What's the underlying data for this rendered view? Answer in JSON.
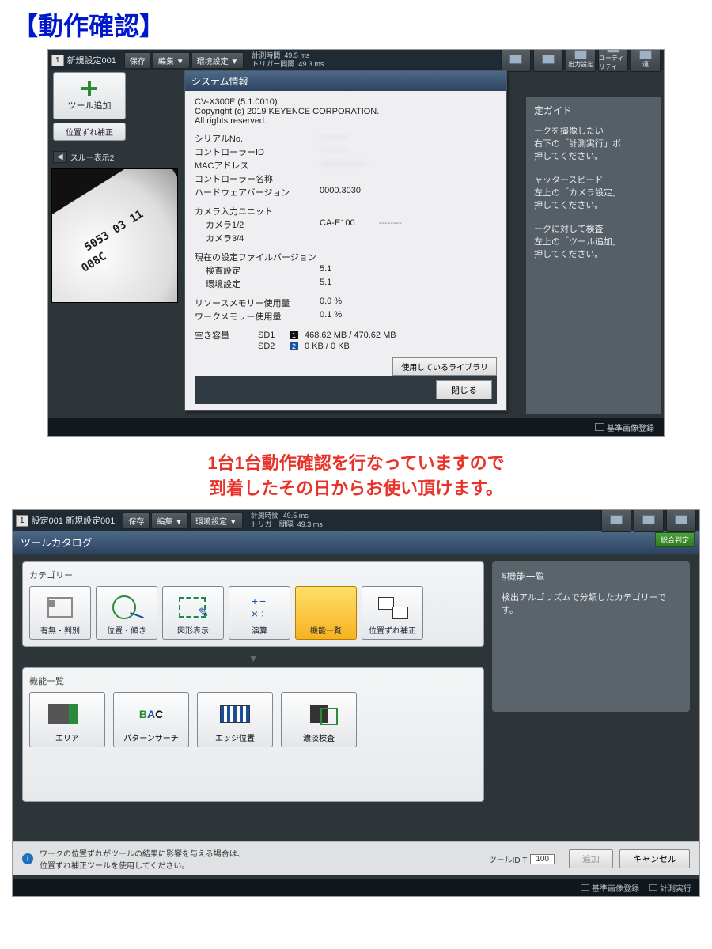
{
  "heading": "【動作確認】",
  "caption_line1": "1台1台動作確認を行なっていますので",
  "caption_line2": "到着したその日からお使い頂けます。",
  "shot1": {
    "appbar": {
      "index": "1",
      "title": "新規設定001",
      "menus": {
        "save": "保存",
        "edit": "編集 ▼",
        "env": "環境設定 ▼"
      },
      "stats": {
        "measure_time_label": "計測時間",
        "measure_time_val": "49.5 ms",
        "trigger_label": "トリガー間隔",
        "trigger_val": "49.3 ms"
      },
      "topicons": {
        "output": "出力設定",
        "utility": "ユーティリティ",
        "run": "運"
      }
    },
    "left_tools": {
      "add_tool": "ツール追加",
      "align_correct": "位置ずれ補正",
      "through": "スルー表示2"
    },
    "preview": {
      "line1": "5053 03 11",
      "line2": "008C"
    },
    "sysinfo": {
      "title": "システム情報",
      "model": "CV-X300E (5.1.0010)",
      "copyright": "Copyright (c) 2019 KEYENCE CORPORATION.",
      "rights": "All rights reserved.",
      "rows": {
        "serial_k": "シリアルNo.",
        "serial_v": "··········",
        "ctrlid_k": "コントローラーID",
        "ctrlid_v": "··········",
        "mac_k": "MACアドレス",
        "mac_v": "··:··:··:··:··:··",
        "ctrlname_k": "コントローラー名称",
        "ctrlname_v": "",
        "hw_k": "ハードウェアバージョン",
        "hw_v": "0000.3030"
      },
      "cam_unit_h": "カメラ入力ユニット",
      "cam12_k": "カメラ1/2",
      "cam12_v": "CA-E100",
      "cam12_extra": "--------",
      "cam34_k": "カメラ3/4",
      "cam34_v": "",
      "filever_h": "現在の設定ファイルバージョン",
      "insp_k": "検査設定",
      "insp_v": "5.1",
      "envs_k": "環境設定",
      "envs_v": "5.1",
      "res_k": "リソースメモリー使用量",
      "res_v": "0.0 %",
      "work_k": "ワークメモリー使用量",
      "work_v": "0.1 %",
      "free_k": "空き容量",
      "sd1_k": "SD1",
      "sd1_v": "468.62 MB / 470.62 MB",
      "sd2_k": "SD2",
      "sd2_v": "0 KB /     0 KB",
      "lib_btn": "使用しているライブラリ",
      "close": "閉じる"
    },
    "guide": {
      "title": "定ガイド",
      "p1a": "ークを撮像したい",
      "p1b": "右下の「計測実行」ボ",
      "p1c": "押してください。",
      "p2a": "ャッタースピード",
      "p2b": "左上の「カメラ設定」",
      "p2c": "押してください。",
      "p3a": "ークに対して検査",
      "p3b": "左上の「ツール追加」",
      "p3c": "押してください。"
    },
    "footer": {
      "baseimg": "基準画像登録"
    }
  },
  "shot2": {
    "appbar": {
      "index": "1",
      "title": "設定001 新規設定001",
      "menus": {
        "save": "保存",
        "edit": "編集 ▼",
        "env": "環境設定 ▼"
      },
      "stats": {
        "measure_time_label": "計測時間",
        "measure_time_val": "49.5 ms",
        "trigger_label": "トリガー間隔",
        "trigger_val": "49.3 ms"
      },
      "ok": "総合判定"
    },
    "catalog": {
      "title": "ツールカタログ",
      "cat_label": "カテゴリー",
      "tiles": {
        "presence": "有無・判別",
        "position": "位置・傾き",
        "graphic": "図形表示",
        "calc": "演算",
        "funcs": "機能一覧",
        "align": "位置ずれ補正"
      },
      "func_label": "機能一覧",
      "func_tiles": {
        "area": "エリア",
        "pattern": "パターンサーチ",
        "edge": "エッジ位置",
        "shade": "濃淡検査"
      },
      "desc_title": "§機能一覧",
      "desc_body": "検出アルゴリズムで分類したカテゴリーです。"
    },
    "footer": {
      "info": "ワークの位置ずれがツールの結果に影響を与える場合は、\n位置ずれ補正ツールを使用してください。",
      "tool_id_label": "ツールID T",
      "tool_id_val": "100",
      "add": "追加",
      "cancel": "キャンセル"
    },
    "bottom": {
      "baseimg": "基準画像登録",
      "run": "計測実行"
    }
  }
}
